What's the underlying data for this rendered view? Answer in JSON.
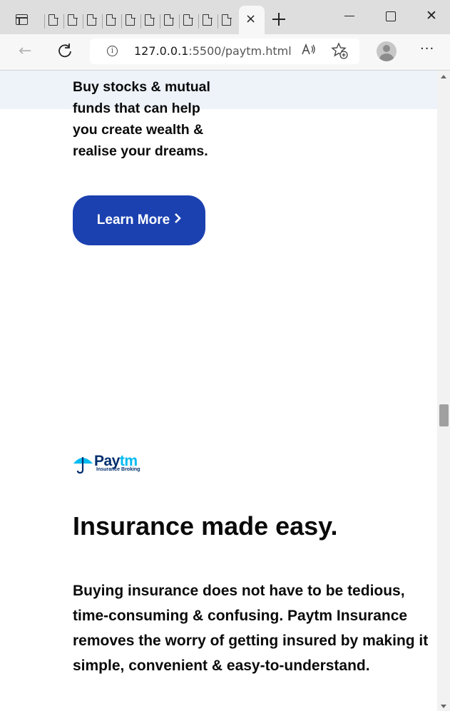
{
  "browser": {
    "url_host": "127.0.0.1",
    "url_rest": ":5500/paytm.html",
    "close_tab_glyph": "×",
    "new_tab_glyph": "+",
    "close_window_glyph": "✕",
    "more_glyph": "···",
    "read_aloud_glyph": "A)",
    "tab_count": 10,
    "icons": [
      "tab-actions-icon",
      "page-icon",
      "close-icon",
      "plus-icon",
      "minimize-icon",
      "maximize-icon",
      "back-arrow-icon",
      "reload-icon",
      "info-icon",
      "read-aloud-icon",
      "add-favorite-icon",
      "profile-icon",
      "more-icon"
    ]
  },
  "page": {
    "promo_text": "Buy stocks & mutual funds that can help you create wealth & realise your dreams.",
    "learn_more_label": "Learn More",
    "learn_more_chevron": "›",
    "logo_pay": "Pay",
    "logo_tm": "tm",
    "logo_subtitle": "Insurance Broking",
    "headline": "Insurance made easy.",
    "body": "Buying insurance does not have to be tedious, time-consuming & confusing. Paytm Insurance removes the worry of getting insured by making it simple, convenient & easy-to-understand."
  },
  "colors": {
    "button_bg": "#1b41b0",
    "band_bg": "#eef3fa",
    "paytm_dark": "#002e6e",
    "paytm_light": "#00baf2"
  }
}
